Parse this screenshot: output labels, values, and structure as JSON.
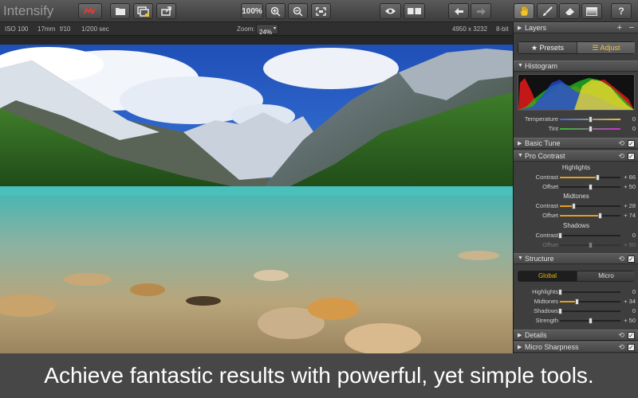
{
  "app": {
    "title": "Intensify"
  },
  "toolbar": {
    "zoom_percent": "100%",
    "accent_color": "#d9262b"
  },
  "infobar": {
    "iso": "ISO 100",
    "focal": "17mm",
    "aperture": "f/10",
    "shutter": "1/200 sec",
    "zoom_label": "Zoom:",
    "zoom_value": "24%",
    "dimensions": "4950 x 3232",
    "bitdepth": "8-bit"
  },
  "panel": {
    "layers_label": "Layers",
    "presets_label": "Presets",
    "adjust_label": "Adjust",
    "histogram_label": "Histogram",
    "temperature": {
      "label": "Temperature",
      "value": "0",
      "level": 0.5
    },
    "tint": {
      "label": "Tint",
      "value": "0",
      "level": 0.5
    },
    "basic_tune_label": "Basic Tune",
    "pro_contrast_label": "Pro Contrast",
    "highlights_title": "Highlights",
    "hl_contrast": {
      "label": "Contrast",
      "value": "+ 66",
      "level": 0.62
    },
    "hl_offset": {
      "label": "Offset",
      "value": "+ 50",
      "level": 0.5
    },
    "midtones_title": "Midtones",
    "mt_contrast": {
      "label": "Contrast",
      "value": "+ 28",
      "level": 0.22
    },
    "mt_offset": {
      "label": "Offset",
      "value": "+ 74",
      "level": 0.66
    },
    "shadows_title": "Shadows",
    "sh_contrast": {
      "label": "Contrast",
      "value": "0",
      "level": 0.0
    },
    "sh_offset": {
      "label": "Offset",
      "value": "+ 50",
      "level": 0.5
    },
    "structure_label": "Structure",
    "global_tab": "Global",
    "micro_tab": "Micro",
    "st_highlights": {
      "label": "Highlights",
      "value": "0",
      "level": 0.0
    },
    "st_midtones": {
      "label": "Midtones",
      "value": "+ 34",
      "level": 0.28
    },
    "st_shadows": {
      "label": "Shadows",
      "value": "0",
      "level": 0.0
    },
    "st_strength": {
      "label": "Strength",
      "value": "+ 50",
      "level": 0.5
    },
    "details_label": "Details",
    "micro_sharpness_label": "Micro Sharpness",
    "global_tab_color": "#e8b400"
  },
  "caption": {
    "text": "Achieve fantastic results with powerful, yet simple tools."
  }
}
